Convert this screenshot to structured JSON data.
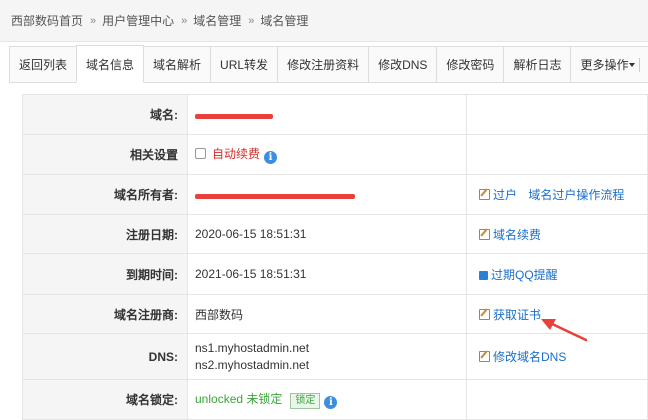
{
  "breadcrumb": [
    "西部数码首页",
    "用户管理中心",
    "域名管理",
    "域名管理"
  ],
  "tabs": [
    "返回列表",
    "域名信息",
    "域名解析",
    "URL转发",
    "修改注册资料",
    "修改DNS",
    "修改密码",
    "解析日志",
    "更多操作"
  ],
  "rows": {
    "domain": {
      "label": "域名:"
    },
    "settings": {
      "label": "相关设置",
      "checkbox_label": "自动续费",
      "info": "i"
    },
    "owner": {
      "label": "域名所有者:",
      "action1": "过户",
      "action2": "域名过户操作流程"
    },
    "reg_date": {
      "label": "注册日期:",
      "value": "2020-06-15 18:51:31",
      "action": "域名续费"
    },
    "exp_date": {
      "label": "到期时间:",
      "value": "2021-06-15 18:51:31",
      "action": "过期QQ提醒"
    },
    "registrar": {
      "label": "域名注册商:",
      "value": "西部数码",
      "action": "获取证书"
    },
    "dns": {
      "label": "DNS:",
      "value1": "ns1.myhostadmin.net",
      "value2": "ns2.myhostadmin.net",
      "action": "修改域名DNS"
    },
    "lock": {
      "label": "域名锁定:",
      "value": "unlocked 未锁定",
      "btn": "锁定",
      "info": "i"
    }
  },
  "colors": {
    "accent": "#1a6fc9",
    "red": "#d0302a",
    "arrow": "#e8403a"
  }
}
